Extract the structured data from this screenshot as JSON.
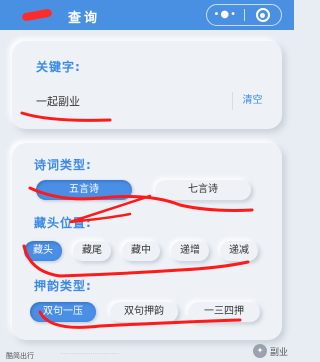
{
  "header": {
    "title": "查询",
    "menu_icon": "more-dots-icon",
    "close_icon": "target-circle-icon",
    "color": "#4a90e2"
  },
  "keyword": {
    "label": "关键字:",
    "value": "一起副业",
    "clear_label": "清空"
  },
  "poem_type": {
    "label": "诗词类型:",
    "options": [
      "五言诗",
      "七言诗"
    ],
    "selected": "五言诗"
  },
  "hidden_position": {
    "label": "藏头位置:",
    "options": [
      "藏头",
      "藏尾",
      "藏中",
      "递增",
      "递减"
    ],
    "selected": "藏头"
  },
  "rhyme_type": {
    "label": "押韵类型:",
    "options": [
      "双句一压",
      "双句押韵",
      "一三四押"
    ],
    "selected": "双句一压"
  },
  "footer": {
    "left": "酷简出行",
    "right": "副业"
  },
  "accent_color": "#3d8ae6",
  "annotation_color": "#ff1a1a"
}
